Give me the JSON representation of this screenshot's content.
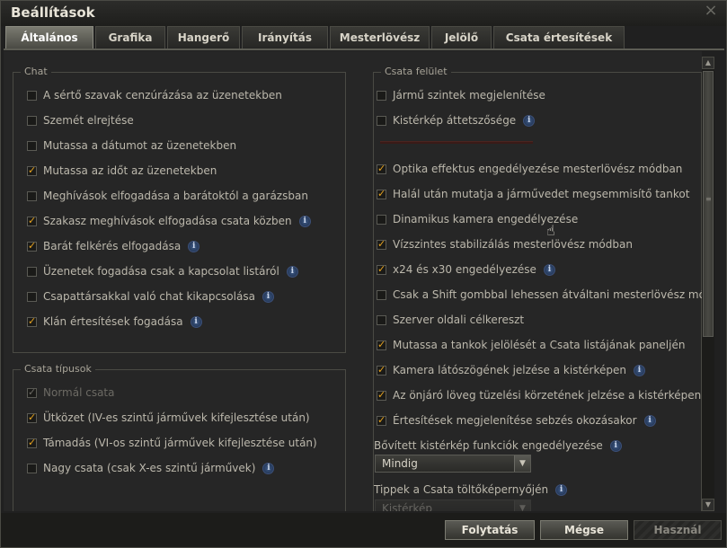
{
  "window": {
    "title": "Beállítások"
  },
  "tabs": [
    {
      "label": "Általános"
    },
    {
      "label": "Grafika"
    },
    {
      "label": "Hangerő"
    },
    {
      "label": "Irányítás"
    },
    {
      "label": "Mesterlövész"
    },
    {
      "label": "Jelölő"
    },
    {
      "label": "Csata értesítések"
    }
  ],
  "chat": {
    "title": "Chat",
    "items": [
      {
        "label": "A sértő szavak cenzúrázása az üzenetekben",
        "checked": false,
        "info": false
      },
      {
        "label": "Szemét elrejtése",
        "checked": false,
        "info": false
      },
      {
        "label": "Mutassa a dátumot az üzenetekben",
        "checked": false,
        "info": false
      },
      {
        "label": "Mutassa az időt az üzenetekben",
        "checked": true,
        "info": false
      },
      {
        "label": "Meghívások elfogadása a barátoktól a garázsban",
        "checked": false,
        "info": false
      },
      {
        "label": "Szakasz meghívások elfogadása csata közben",
        "checked": true,
        "info": true
      },
      {
        "label": "Barát felkérés elfogadása",
        "checked": true,
        "info": true
      },
      {
        "label": "Üzenetek fogadása csak a kapcsolat listáról",
        "checked": false,
        "info": true
      },
      {
        "label": "Csapattársakkal való chat kikapcsolása",
        "checked": false,
        "info": true
      },
      {
        "label": "Klán értesítések fogadása",
        "checked": true,
        "info": true
      }
    ]
  },
  "battle_types": {
    "title": "Csata típusok",
    "items": [
      {
        "label": "Normál csata",
        "checked": true,
        "disabled": true,
        "info": false
      },
      {
        "label": "Ütközet (IV-es szintű járművek kifejlesztése után)",
        "checked": true,
        "disabled": false,
        "info": false
      },
      {
        "label": "Támadás (VI-os szintű járművek kifejlesztése után)",
        "checked": true,
        "disabled": false,
        "info": false
      },
      {
        "label": "Nagy csata (csak X-es szintű járművek)",
        "checked": false,
        "disabled": false,
        "info": true
      }
    ]
  },
  "battle_ui": {
    "title": "Csata felület",
    "top_items": [
      {
        "label": "Jármű szintek megjelenítése",
        "checked": false,
        "info": false
      },
      {
        "label": "Kistérkép áttetszősége",
        "checked": false,
        "info": true
      }
    ],
    "items": [
      {
        "label": "Optika effektus engedélyezése mesterlövész módban",
        "checked": true,
        "info": false
      },
      {
        "label": "Halál után mutatja a járművedet megsemmisítő tankot",
        "checked": true,
        "info": false
      },
      {
        "label": "Dinamikus kamera engedélyezése",
        "checked": false,
        "info": false
      },
      {
        "label": "Vízszintes stabilizálás mesterlövész módban",
        "checked": true,
        "info": false
      },
      {
        "label": "x24 és x30 engedélyezése",
        "checked": true,
        "info": true
      },
      {
        "label": "Csak a Shift gombbal lehessen átváltani mesterlövész módba",
        "checked": false,
        "info": false
      },
      {
        "label": "Szerver oldali célkereszt",
        "checked": false,
        "info": false
      },
      {
        "label": "Mutassa a tankok jelölését a Csata listájának paneljén",
        "checked": true,
        "info": false
      },
      {
        "label": "Kamera látószögének jelzése a kistérképen",
        "checked": true,
        "info": true
      },
      {
        "label": "Az önjáró löveg tüzelési körzetének jelzése a kistérképen",
        "checked": true,
        "info": true
      },
      {
        "label": "Értesítések megjelenítése sebzés okozásakor",
        "checked": true,
        "info": true
      }
    ],
    "minimap_label": "Bővített kistérkép funkciók engedélyezése",
    "minimap_value": "Mindig",
    "tips_label": "Tippek a Csata töltőképernyőjén",
    "tips_value": "Kistérkép"
  },
  "footer": {
    "continue": "Folytatás",
    "cancel": "Mégse",
    "apply": "Használ"
  },
  "icons": {
    "info": "i",
    "close": "×",
    "dropdown": "▼",
    "scroll_up": "▲",
    "scroll_down": "▼"
  }
}
